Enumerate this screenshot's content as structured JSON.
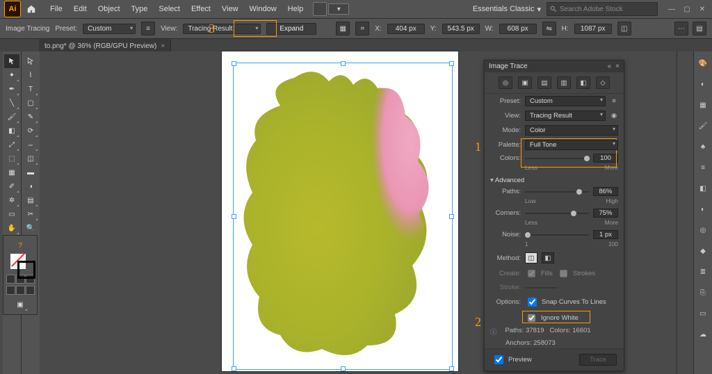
{
  "app_badge": "Ai",
  "menu": [
    "File",
    "Edit",
    "Object",
    "Type",
    "Select",
    "Effect",
    "View",
    "Window",
    "Help"
  ],
  "workspace": "Essentials Classic",
  "search_placeholder": "Search Adobe Stock",
  "optbar": {
    "leading": "Image Tracing",
    "preset_label": "Preset:",
    "preset_value": "Custom",
    "view_label": "View:",
    "view_value": "Tracing Result",
    "expand_label": "Expand",
    "x_label": "X:",
    "x_value": "404 px",
    "y_label": "Y:",
    "y_value": "543.5 px",
    "w_label": "W:",
    "w_value": "608 px",
    "h_label": "H:",
    "h_value": "1087 px"
  },
  "doc_tab": "to.png* @ 36% (RGB/GPU Preview)",
  "marks": {
    "one": "1",
    "two": "2",
    "three": "3"
  },
  "panel": {
    "title": "Image Trace",
    "preset_label": "Preset:",
    "preset_value": "Custom",
    "view_label": "View:",
    "view_value": "Tracing Result",
    "mode_label": "Mode:",
    "mode_value": "Color",
    "palette_label": "Palette:",
    "palette_value": "Full Tone",
    "colors_label": "Colors:",
    "colors_value": "100",
    "colors_less": "Less",
    "colors_more": "More",
    "advanced_label": "Advanced",
    "paths_label": "Paths:",
    "paths_value": "86%",
    "paths_low": "Low",
    "paths_high": "High",
    "corners_label": "Corners:",
    "corners_value": "75%",
    "corners_less": "Less",
    "corners_more": "More",
    "noise_label": "Noise:",
    "noise_value": "1 px",
    "noise_low": "1",
    "noise_high": "100",
    "method_label": "Method:",
    "create_label": "Create:",
    "create_fills": "Fills",
    "create_strokes": "Strokes",
    "stroke_label": "Stroke:",
    "options_label": "Options:",
    "opt_snap": "Snap Curves To Lines",
    "opt_ignore": "Ignore White",
    "stats_paths_label": "Paths:",
    "stats_paths": "37819",
    "stats_colors_label": "Colors:",
    "stats_colors": "16601",
    "stats_anchors_label": "Anchors:",
    "stats_anchors": "258073",
    "preview_label": "Preview",
    "trace_btn": "Trace"
  },
  "tools_left_a": [
    "selection-tool",
    "direct-selection-tool",
    "magic-wand-tool",
    "lasso-tool",
    "pen-tool",
    "type-tool",
    "line-tool",
    "rectangle-tool",
    "brush-tool",
    "pencil-tool",
    "eraser-tool",
    "rotate-tool",
    "scale-tool",
    "width-tool",
    "free-transform-tool",
    "shape-builder-tool",
    "perspective-tool",
    "mesh-tool",
    "gradient-tool",
    "eyedropper-tool",
    "blend-tool",
    "symbol-sprayer-tool",
    "graph-tool",
    "artboard-tool",
    "slice-tool"
  ],
  "right_rail": [
    "color-panel-icon",
    "swatches-panel-icon",
    "brushes-panel-icon",
    "symbols-panel-icon",
    "stroke-panel-icon",
    "gradient-panel-icon",
    "transparency-panel-icon",
    "appearance-panel-icon",
    "graphic-styles-panel-icon",
    "layers-panel-icon",
    "asset-export-panel-icon",
    "artboards-panel-icon",
    "libraries-panel-icon",
    "properties-panel-icon"
  ]
}
